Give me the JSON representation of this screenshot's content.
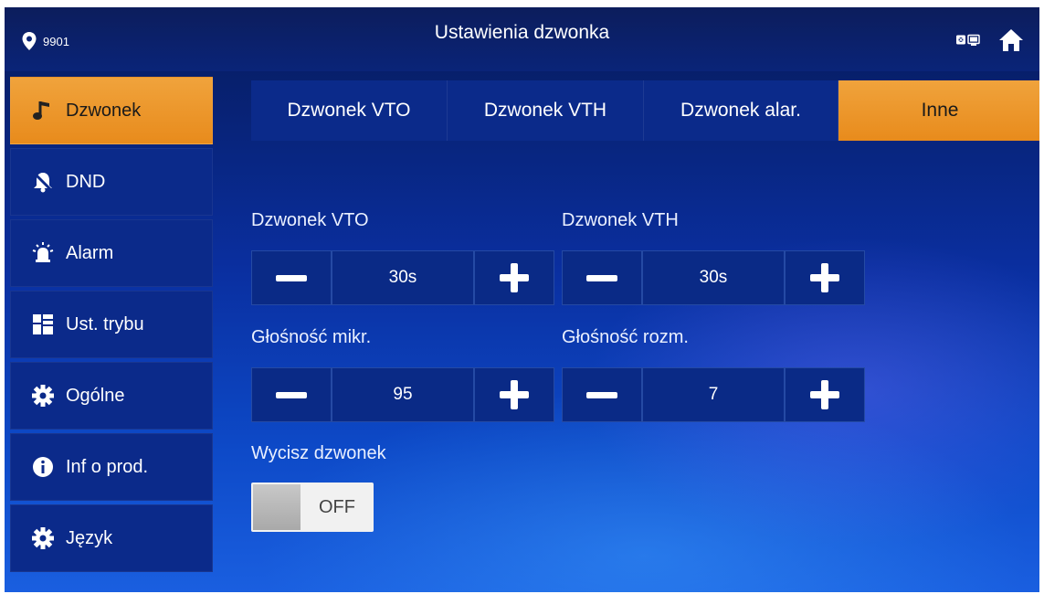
{
  "header": {
    "location": "9901",
    "title": "Ustawienia dzwonka",
    "icons": [
      "location-pin-icon",
      "monitor-network-icon",
      "home-icon"
    ]
  },
  "sidebar": {
    "items": [
      {
        "label": "Dzwonek",
        "icon": "music-note-icon",
        "active": true
      },
      {
        "label": "DND",
        "icon": "bell-mute-icon",
        "active": false
      },
      {
        "label": "Alarm",
        "icon": "alarm-siren-icon",
        "active": false
      },
      {
        "label": "Ust. trybu",
        "icon": "mode-grid-icon",
        "active": false
      },
      {
        "label": "Ogólne",
        "icon": "gear-icon",
        "active": false
      },
      {
        "label": "Inf o prod.",
        "icon": "info-icon",
        "active": false
      },
      {
        "label": "Język",
        "icon": "gear-icon",
        "active": false
      }
    ]
  },
  "tabs": [
    {
      "label": "Dzwonek VTO",
      "active": false
    },
    {
      "label": "Dzwonek VTH",
      "active": false
    },
    {
      "label": "Dzwonek alar.",
      "active": false
    },
    {
      "label": "Inne",
      "active": true
    }
  ],
  "settings": {
    "vto_ring": {
      "label": "Dzwonek VTO",
      "value": "30s"
    },
    "vth_ring": {
      "label": "Dzwonek VTH",
      "value": "30s"
    },
    "mic_volume": {
      "label": "Głośność mikr.",
      "value": "95"
    },
    "talk_volume": {
      "label": "Głośność rozm.",
      "value": "7"
    },
    "mute_ring": {
      "label": "Wycisz dzwonek",
      "state": "OFF"
    }
  },
  "colors": {
    "accent": "#e88b1c",
    "panel": "#0b2a8a"
  }
}
